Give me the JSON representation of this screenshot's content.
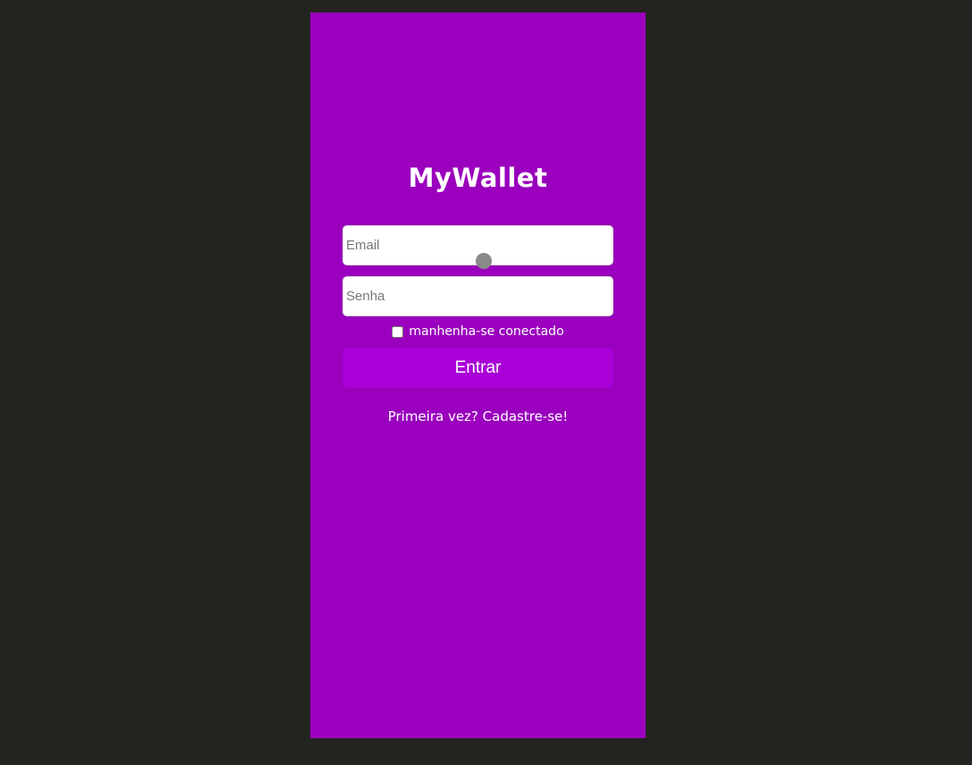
{
  "app": {
    "logo": "MyWallet"
  },
  "form": {
    "email_placeholder": "Email",
    "password_placeholder": "Senha",
    "remember_label": "manhenha-se conectado",
    "remember_checked": false,
    "submit_label": "Entrar",
    "signup_link": "Primeira vez? Cadastre-se!"
  },
  "colors": {
    "page_background": "#232320",
    "panel_background": "#9a00bd",
    "button_background": "#a800d6",
    "text": "#ffffff"
  }
}
